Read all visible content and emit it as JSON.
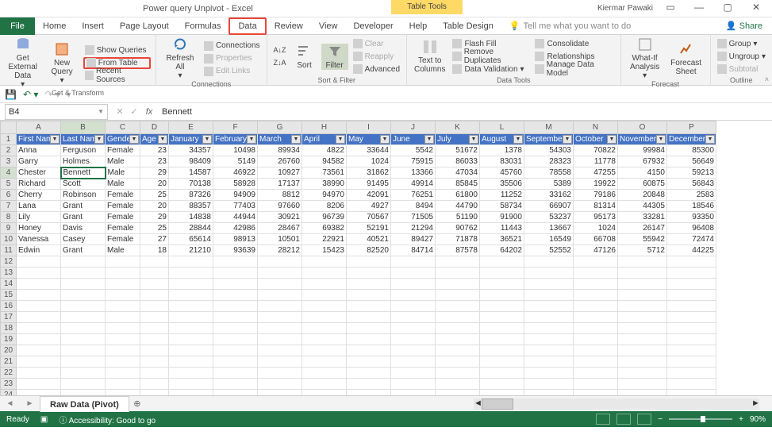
{
  "titlebar": {
    "app_title": "Power query Unpivot  -  Excel",
    "context_tab_group": "Table Tools",
    "user": "Kiermar Pawaki"
  },
  "tabs": {
    "file": "File",
    "home": "Home",
    "insert": "Insert",
    "pagelayout": "Page Layout",
    "formulas": "Formulas",
    "data": "Data",
    "review": "Review",
    "view": "View",
    "developer": "Developer",
    "help": "Help",
    "tabledesign": "Table Design",
    "tell": "Tell me what you want to do",
    "share": "Share"
  },
  "ribbon": {
    "get_transform": {
      "get_external": "Get External\nData",
      "new_query": "New\nQuery",
      "show_queries": "Show Queries",
      "from_table": "From Table",
      "recent_sources": "Recent Sources",
      "label": "Get & Transform"
    },
    "connections": {
      "refresh": "Refresh\nAll",
      "connections": "Connections",
      "properties": "Properties",
      "edit_links": "Edit Links",
      "label": "Connections"
    },
    "sort_filter": {
      "sort": "Sort",
      "filter": "Filter",
      "clear": "Clear",
      "reapply": "Reapply",
      "advanced": "Advanced",
      "label": "Sort & Filter"
    },
    "data_tools": {
      "text_columns": "Text to\nColumns",
      "flash_fill": "Flash Fill",
      "remove_dup": "Remove Duplicates",
      "data_val": "Data Validation",
      "consolidate": "Consolidate",
      "relationships": "Relationships",
      "manage_dm": "Manage Data Model",
      "label": "Data Tools"
    },
    "forecast": {
      "whatif": "What-If\nAnalysis",
      "forecast_sheet": "Forecast\nSheet",
      "label": "Forecast"
    },
    "outline": {
      "group": "Group",
      "ungroup": "Ungroup",
      "subtotal": "Subtotal",
      "label": "Outline"
    }
  },
  "namebox": "B4",
  "formula": "Bennett",
  "columns": [
    "A",
    "B",
    "C",
    "D",
    "E",
    "F",
    "G",
    "H",
    "I",
    "J",
    "K",
    "L",
    "M",
    "N",
    "O",
    "P"
  ],
  "headers": [
    "First Name",
    "Last Name",
    "Gender",
    "Age",
    "January",
    "February",
    "March",
    "April",
    "May",
    "June",
    "July",
    "August",
    "September",
    "October",
    "November",
    "December"
  ],
  "rows": [
    {
      "n": 1
    },
    {
      "n": 2,
      "d": [
        "Anna",
        "Ferguson",
        "Female",
        "23",
        "34357",
        "10498",
        "89934",
        "4822",
        "33644",
        "5542",
        "51672",
        "1378",
        "54303",
        "70822",
        "99984",
        "85300"
      ]
    },
    {
      "n": 3,
      "d": [
        "Garry",
        "Holmes",
        "Male",
        "23",
        "98409",
        "5149",
        "26760",
        "94582",
        "1024",
        "75915",
        "86033",
        "83031",
        "28323",
        "11778",
        "67932",
        "56649"
      ]
    },
    {
      "n": 4,
      "d": [
        "Chester",
        "Bennett",
        "Male",
        "29",
        "14587",
        "46922",
        "10927",
        "73561",
        "31862",
        "13366",
        "47034",
        "45760",
        "78558",
        "47255",
        "4150",
        "59213"
      ]
    },
    {
      "n": 5,
      "d": [
        "Richard",
        "Scott",
        "Male",
        "20",
        "70138",
        "58928",
        "17137",
        "38990",
        "91495",
        "49914",
        "85845",
        "35506",
        "5389",
        "19922",
        "60875",
        "56843"
      ]
    },
    {
      "n": 6,
      "d": [
        "Cherry",
        "Robinson",
        "Female",
        "25",
        "87326",
        "94909",
        "8812",
        "94970",
        "42091",
        "76251",
        "61800",
        "11252",
        "33162",
        "79186",
        "20848",
        "2583"
      ]
    },
    {
      "n": 7,
      "d": [
        "Lana",
        "Grant",
        "Female",
        "20",
        "88357",
        "77403",
        "97660",
        "8206",
        "4927",
        "8494",
        "44790",
        "58734",
        "66907",
        "81314",
        "44305",
        "18546"
      ]
    },
    {
      "n": 8,
      "d": [
        "Lily",
        "Grant",
        "Female",
        "29",
        "14838",
        "44944",
        "30921",
        "96739",
        "70567",
        "71505",
        "51190",
        "91900",
        "53237",
        "95173",
        "33281",
        "93350"
      ]
    },
    {
      "n": 9,
      "d": [
        "Honey",
        "Davis",
        "Female",
        "25",
        "28844",
        "42986",
        "28467",
        "69382",
        "52191",
        "21294",
        "90762",
        "11443",
        "13667",
        "1024",
        "26147",
        "96408"
      ]
    },
    {
      "n": 10,
      "d": [
        "Vanessa",
        "Casey",
        "Female",
        "27",
        "65614",
        "98913",
        "10501",
        "22921",
        "40521",
        "89427",
        "71878",
        "36521",
        "16549",
        "66708",
        "55942",
        "72474"
      ]
    },
    {
      "n": 11,
      "d": [
        "Edwin",
        "Grant",
        "Male",
        "18",
        "21210",
        "93639",
        "28212",
        "15423",
        "82520",
        "84714",
        "87578",
        "64202",
        "52552",
        "47126",
        "5712",
        "44225"
      ]
    }
  ],
  "chart_data": {
    "type": "table",
    "columns": [
      "First Name",
      "Last Name",
      "Gender",
      "Age",
      "January",
      "February",
      "March",
      "April",
      "May",
      "June",
      "July",
      "August",
      "September",
      "October",
      "November",
      "December"
    ],
    "data": [
      [
        "Anna",
        "Ferguson",
        "Female",
        23,
        34357,
        10498,
        89934,
        4822,
        33644,
        5542,
        51672,
        1378,
        54303,
        70822,
        99984,
        85300
      ],
      [
        "Garry",
        "Holmes",
        "Male",
        23,
        98409,
        5149,
        26760,
        94582,
        1024,
        75915,
        86033,
        83031,
        28323,
        11778,
        67932,
        56649
      ],
      [
        "Chester",
        "Bennett",
        "Male",
        29,
        14587,
        46922,
        10927,
        73561,
        31862,
        13366,
        47034,
        45760,
        78558,
        47255,
        4150,
        59213
      ],
      [
        "Richard",
        "Scott",
        "Male",
        20,
        70138,
        58928,
        17137,
        38990,
        91495,
        49914,
        85845,
        35506,
        5389,
        19922,
        60875,
        56843
      ],
      [
        "Cherry",
        "Robinson",
        "Female",
        25,
        87326,
        94909,
        8812,
        94970,
        42091,
        76251,
        61800,
        11252,
        33162,
        79186,
        20848,
        2583
      ],
      [
        "Lana",
        "Grant",
        "Female",
        20,
        88357,
        77403,
        97660,
        8206,
        4927,
        8494,
        44790,
        58734,
        66907,
        81314,
        44305,
        18546
      ],
      [
        "Lily",
        "Grant",
        "Female",
        29,
        14838,
        44944,
        30921,
        96739,
        70567,
        71505,
        51190,
        91900,
        53237,
        95173,
        33281,
        93350
      ],
      [
        "Honey",
        "Davis",
        "Female",
        25,
        28844,
        42986,
        28467,
        69382,
        52191,
        21294,
        90762,
        11443,
        13667,
        1024,
        26147,
        96408
      ],
      [
        "Vanessa",
        "Casey",
        "Female",
        27,
        65614,
        98913,
        10501,
        22921,
        40521,
        89427,
        71878,
        36521,
        16549,
        66708,
        55942,
        72474
      ],
      [
        "Edwin",
        "Grant",
        "Male",
        18,
        21210,
        93639,
        28212,
        15423,
        82520,
        84714,
        87578,
        64202,
        52552,
        47126,
        5712,
        44225
      ]
    ]
  },
  "sheet": {
    "name": "Raw Data (Pivot)"
  },
  "status": {
    "ready": "Ready",
    "access": "Accessibility: Good to go",
    "zoom": "90%"
  }
}
